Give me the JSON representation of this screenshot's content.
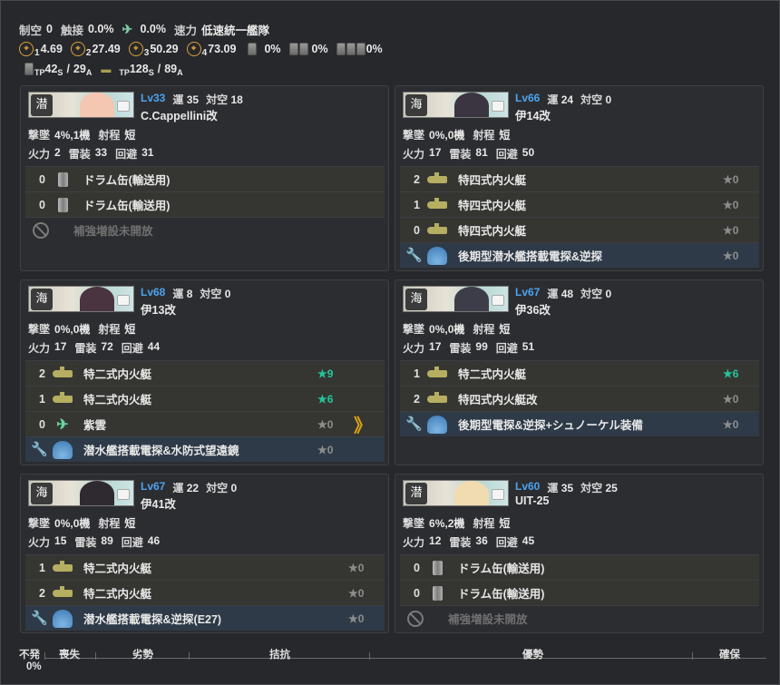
{
  "fleet": {
    "line1": {
      "air_label": "制空",
      "air_value": "0",
      "contact_label": "触接",
      "contact_value": "0.0%",
      "bomb_value": "0.0%",
      "speed_label": "速力",
      "speed_value": "低速統一艦隊"
    },
    "line2": {
      "los": [
        {
          "sub": "1",
          "value": "4.69"
        },
        {
          "sub": "2",
          "value": "27.49"
        },
        {
          "sub": "3",
          "value": "50.29"
        },
        {
          "sub": "4",
          "value": "73.09"
        }
      ],
      "drum1": "0%",
      "drum2": "0%",
      "drum3": "0%"
    },
    "line3": {
      "tp_drum_label": "TP",
      "tp_drum_s": "42",
      "tp_drum_s_sub": "S",
      "tp_drum_a": "29",
      "tp_drum_a_sub": "A",
      "tp_boat_label": "TP",
      "tp_boat_s": "128",
      "tp_boat_s_sub": "S",
      "tp_boat_a": "89",
      "tp_boat_a_sub": "A"
    }
  },
  "ships": [
    {
      "lv": "Lv33",
      "luck_label": "運",
      "luck": "35",
      "aa_label": "対空",
      "aa": "18",
      "name": "C.Cappellini改",
      "banner_char": "潜",
      "shoot_label": "撃墜",
      "shoot": "4%,1機",
      "range_label": "射程",
      "range": "短",
      "fire_label": "火力",
      "fire": "2",
      "torp_label": "雷装",
      "torp": "33",
      "eva_label": "回避",
      "eva": "31",
      "equips": [
        {
          "type": "drum",
          "count": "0",
          "name": "ドラム缶(輸送用)",
          "star": ""
        },
        {
          "type": "drum",
          "count": "0",
          "name": "ドラム缶(輸送用)",
          "star": ""
        },
        {
          "type": "noslot",
          "count": "",
          "name": "補強増設未開放",
          "star": ""
        }
      ]
    },
    {
      "lv": "Lv66",
      "luck_label": "運",
      "luck": "24",
      "aa_label": "対空",
      "aa": "0",
      "name": "伊14改",
      "banner_char": "海",
      "shoot_label": "撃墜",
      "shoot": "0%,0機",
      "range_label": "射程",
      "range": "短",
      "fire_label": "火力",
      "fire": "17",
      "torp_label": "雷装",
      "torp": "81",
      "eva_label": "回避",
      "eva": "50",
      "equips": [
        {
          "type": "sub",
          "count": "2",
          "name": "特四式内火艇",
          "star": "★0"
        },
        {
          "type": "sub",
          "count": "1",
          "name": "特四式内火艇",
          "star": "★0"
        },
        {
          "type": "sub",
          "count": "0",
          "name": "特四式内火艇",
          "star": "★0"
        },
        {
          "type": "ex",
          "count": "",
          "name": "後期型潜水艦搭載電探&逆探",
          "star": "★0"
        }
      ]
    },
    {
      "lv": "Lv68",
      "luck_label": "運",
      "luck": "8",
      "aa_label": "対空",
      "aa": "0",
      "name": "伊13改",
      "banner_char": "海",
      "shoot_label": "撃墜",
      "shoot": "0%,0機",
      "range_label": "射程",
      "range": "短",
      "fire_label": "火力",
      "fire": "17",
      "torp_label": "雷装",
      "torp": "72",
      "eva_label": "回避",
      "eva": "44",
      "equips": [
        {
          "type": "sub",
          "count": "2",
          "name": "特二式内火艇",
          "star": "★9",
          "up": true
        },
        {
          "type": "sub",
          "count": "1",
          "name": "特二式内火艇",
          "star": "★6",
          "up": true
        },
        {
          "type": "plane",
          "count": "0",
          "name": "紫雲",
          "star": "★0",
          "prof": "》"
        },
        {
          "type": "ex",
          "count": "",
          "name": "潜水艦搭載電探&水防式望遠鏡",
          "star": "★0"
        }
      ]
    },
    {
      "lv": "Lv67",
      "luck_label": "運",
      "luck": "48",
      "aa_label": "対空",
      "aa": "0",
      "name": "伊36改",
      "banner_char": "海",
      "shoot_label": "撃墜",
      "shoot": "0%,0機",
      "range_label": "射程",
      "range": "短",
      "fire_label": "火力",
      "fire": "17",
      "torp_label": "雷装",
      "torp": "99",
      "eva_label": "回避",
      "eva": "51",
      "equips": [
        {
          "type": "sub",
          "count": "1",
          "name": "特二式内火艇",
          "star": "★6",
          "up": true
        },
        {
          "type": "sub",
          "count": "2",
          "name": "特四式内火艇改",
          "star": "★0"
        },
        {
          "type": "ex",
          "count": "",
          "name": "後期型電探&逆探+シュノーケル装備",
          "star": "★0"
        }
      ]
    },
    {
      "lv": "Lv67",
      "luck_label": "運",
      "luck": "22",
      "aa_label": "対空",
      "aa": "0",
      "name": "伊41改",
      "banner_char": "海",
      "shoot_label": "撃墜",
      "shoot": "0%,0機",
      "range_label": "射程",
      "range": "短",
      "fire_label": "火力",
      "fire": "15",
      "torp_label": "雷装",
      "torp": "89",
      "eva_label": "回避",
      "eva": "46",
      "equips": [
        {
          "type": "sub",
          "count": "1",
          "name": "特二式内火艇",
          "star": "★0"
        },
        {
          "type": "sub",
          "count": "2",
          "name": "特二式内火艇",
          "star": "★0"
        },
        {
          "type": "ex",
          "count": "",
          "name": "潜水艦搭載電探&逆探(E27)",
          "star": "★0"
        }
      ]
    },
    {
      "lv": "Lv60",
      "luck_label": "運",
      "luck": "35",
      "aa_label": "対空",
      "aa": "25",
      "name": "UIT-25",
      "banner_char": "潜",
      "shoot_label": "撃墜",
      "shoot": "6%,2機",
      "range_label": "射程",
      "range": "短",
      "fire_label": "火力",
      "fire": "12",
      "torp_label": "雷装",
      "torp": "36",
      "eva_label": "回避",
      "eva": "45",
      "equips": [
        {
          "type": "drum",
          "count": "0",
          "name": "ドラム缶(輸送用)",
          "star": ""
        },
        {
          "type": "drum",
          "count": "0",
          "name": "ドラム缶(輸送用)",
          "star": ""
        },
        {
          "type": "noslot",
          "count": "",
          "name": "補強増設未開放",
          "star": ""
        }
      ]
    }
  ],
  "result_bar": {
    "fail_label": "不発",
    "fail_value": "0%",
    "segments": [
      "喪失",
      "劣勢",
      "拮抗",
      "優勢",
      "確保"
    ]
  },
  "colors": {
    "level": "#4ba3ee",
    "star_up": "#22c59a",
    "proficiency": "#e0a412",
    "background": "#27282c"
  }
}
